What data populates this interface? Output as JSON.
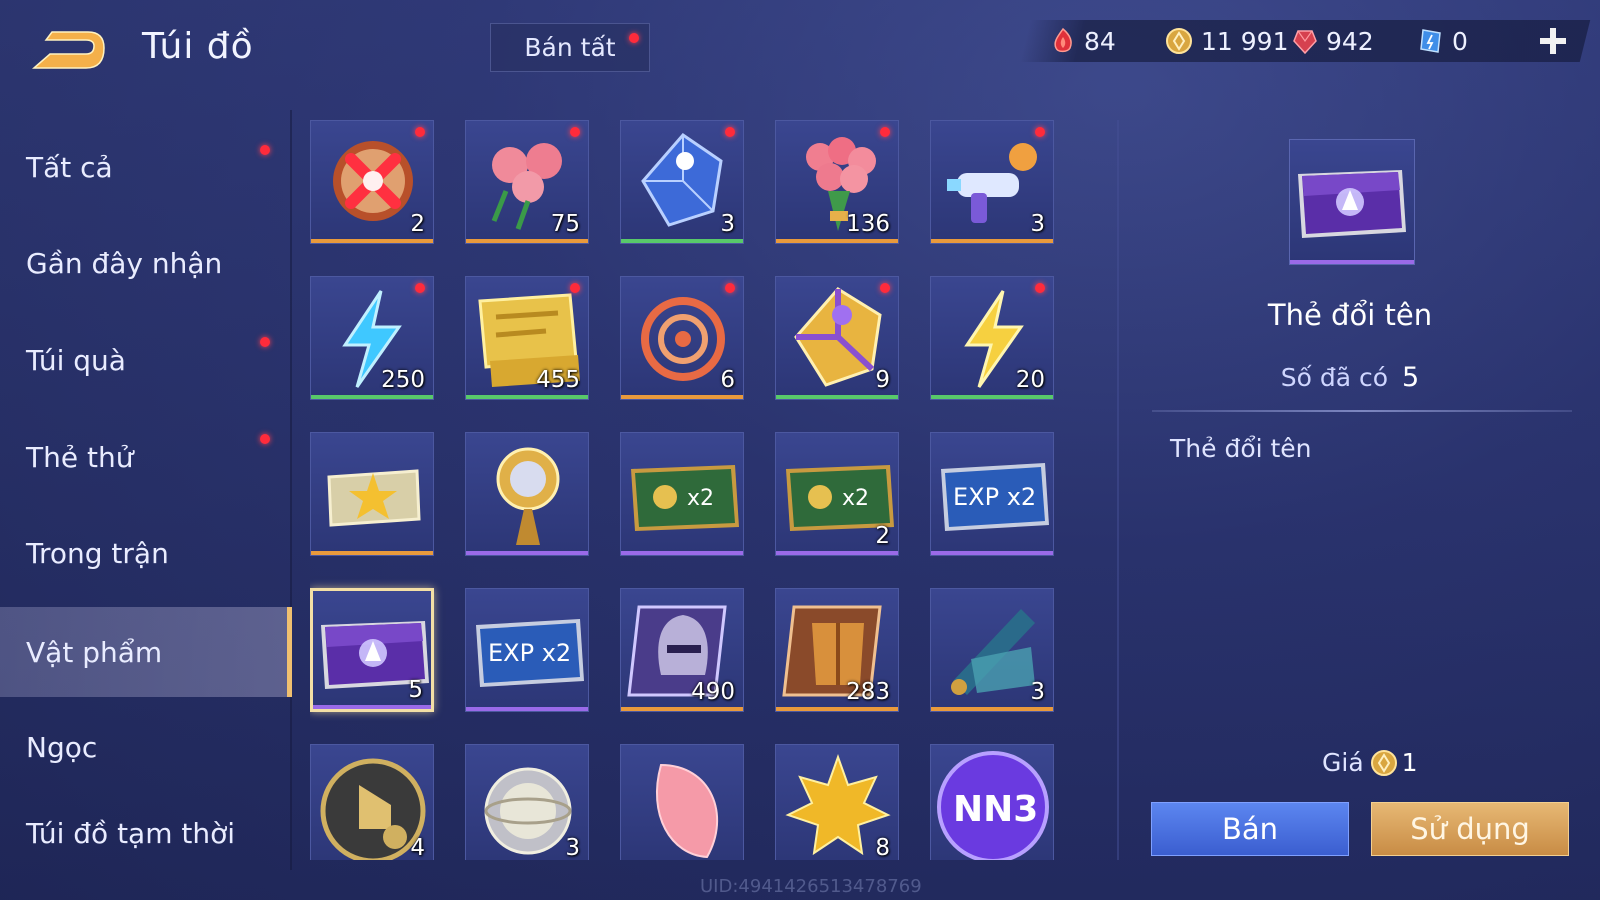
{
  "header": {
    "title": "Túi đồ",
    "sell_all": "Bán tất"
  },
  "currencies": [
    {
      "icon": "red-gem-flame-icon",
      "value": "84"
    },
    {
      "icon": "gold-coin-icon",
      "value": "11 991"
    },
    {
      "icon": "ruby-icon",
      "value": "942"
    },
    {
      "icon": "blue-ticket-icon",
      "value": "0"
    }
  ],
  "sidebar": {
    "items": [
      {
        "label": "Tất cả",
        "dot": true
      },
      {
        "label": "Gần đây nhận",
        "dot": false
      },
      {
        "label": "Túi quà",
        "dot": true
      },
      {
        "label": "Thẻ thử",
        "dot": true
      },
      {
        "label": "Trong trận",
        "dot": false
      },
      {
        "label": "Vật phẩm",
        "dot": false,
        "active": true
      },
      {
        "label": "Ngọc",
        "dot": false
      },
      {
        "label": "Túi đồ tạm thời",
        "dot": false
      }
    ]
  },
  "grid": {
    "items": [
      {
        "icon": "glowing-x-orb-icon",
        "count": "2",
        "rarity": "o",
        "dot": true
      },
      {
        "icon": "roses-icon",
        "count": "75",
        "rarity": "o",
        "dot": true
      },
      {
        "icon": "blue-dice-icon",
        "count": "3",
        "rarity": "g",
        "dot": true
      },
      {
        "icon": "rose-bouquet-icon",
        "count": "136",
        "rarity": "o",
        "dot": true
      },
      {
        "icon": "toy-blaster-icon",
        "count": "3",
        "rarity": "o",
        "dot": true
      },
      {
        "icon": "blue-lightning-icon",
        "count": "250",
        "rarity": "g",
        "dot": true
      },
      {
        "icon": "golden-ticket-icon",
        "count": "455",
        "rarity": "g",
        "dot": true
      },
      {
        "icon": "red-rune-icon",
        "count": "6",
        "rarity": "o",
        "dot": true
      },
      {
        "icon": "gold-dice-icon",
        "count": "9",
        "rarity": "g",
        "dot": true
      },
      {
        "icon": "yellow-lightning-icon",
        "count": "20",
        "rarity": "g",
        "dot": true
      },
      {
        "icon": "star-ticket-icon",
        "count": "",
        "rarity": "o",
        "dot": false
      },
      {
        "icon": "golden-scepter-icon",
        "count": "",
        "rarity": "p",
        "dot": false
      },
      {
        "icon": "gold-x2-card-icon",
        "count": "",
        "rarity": "p",
        "dot": false
      },
      {
        "icon": "gold-x2-card-icon",
        "count": "2",
        "rarity": "p",
        "dot": false
      },
      {
        "icon": "exp-x2-card-icon",
        "count": "",
        "rarity": "p",
        "dot": false
      },
      {
        "icon": "rename-card-icon",
        "count": "5",
        "rarity": "p",
        "dot": false,
        "selected": true
      },
      {
        "icon": "exp-x2-card-icon",
        "count": "",
        "rarity": "p",
        "dot": false
      },
      {
        "icon": "helmet-icon",
        "count": "490",
        "rarity": "o",
        "dot": false
      },
      {
        "icon": "armor-icon",
        "count": "283",
        "rarity": "o",
        "dot": false
      },
      {
        "icon": "scroll-map-icon",
        "count": "3",
        "rarity": "o",
        "dot": false
      },
      {
        "icon": "tap-badge-icon",
        "count": "4",
        "rarity": "o",
        "dot": false
      },
      {
        "icon": "silver-orb-icon",
        "count": "3",
        "rarity": "o",
        "dot": false
      },
      {
        "icon": "petal-icon",
        "count": "",
        "rarity": "o",
        "dot": false
      },
      {
        "icon": "maple-leaf-icon",
        "count": "8",
        "rarity": "o",
        "dot": false
      },
      {
        "icon": "nn3-badge-icon",
        "count": "",
        "rarity": "o",
        "dot": false
      }
    ]
  },
  "detail": {
    "name": "Thẻ đổi tên",
    "owned_label": "Số đã có",
    "owned_value": "5",
    "description": "Thẻ đổi tên",
    "price_label": "Giá",
    "price_value": "1",
    "sell_button": "Bán",
    "use_button": "Sử dụng"
  },
  "uid": "UID:4941426513478769",
  "colors": {
    "rarity_orange": "#e99a3c",
    "rarity_green": "#58c96a",
    "rarity_purple": "#9a6ae8",
    "red_dot": "#ff2b3b",
    "sell_btn": "#4a72e0",
    "use_btn": "#d9a55e"
  }
}
